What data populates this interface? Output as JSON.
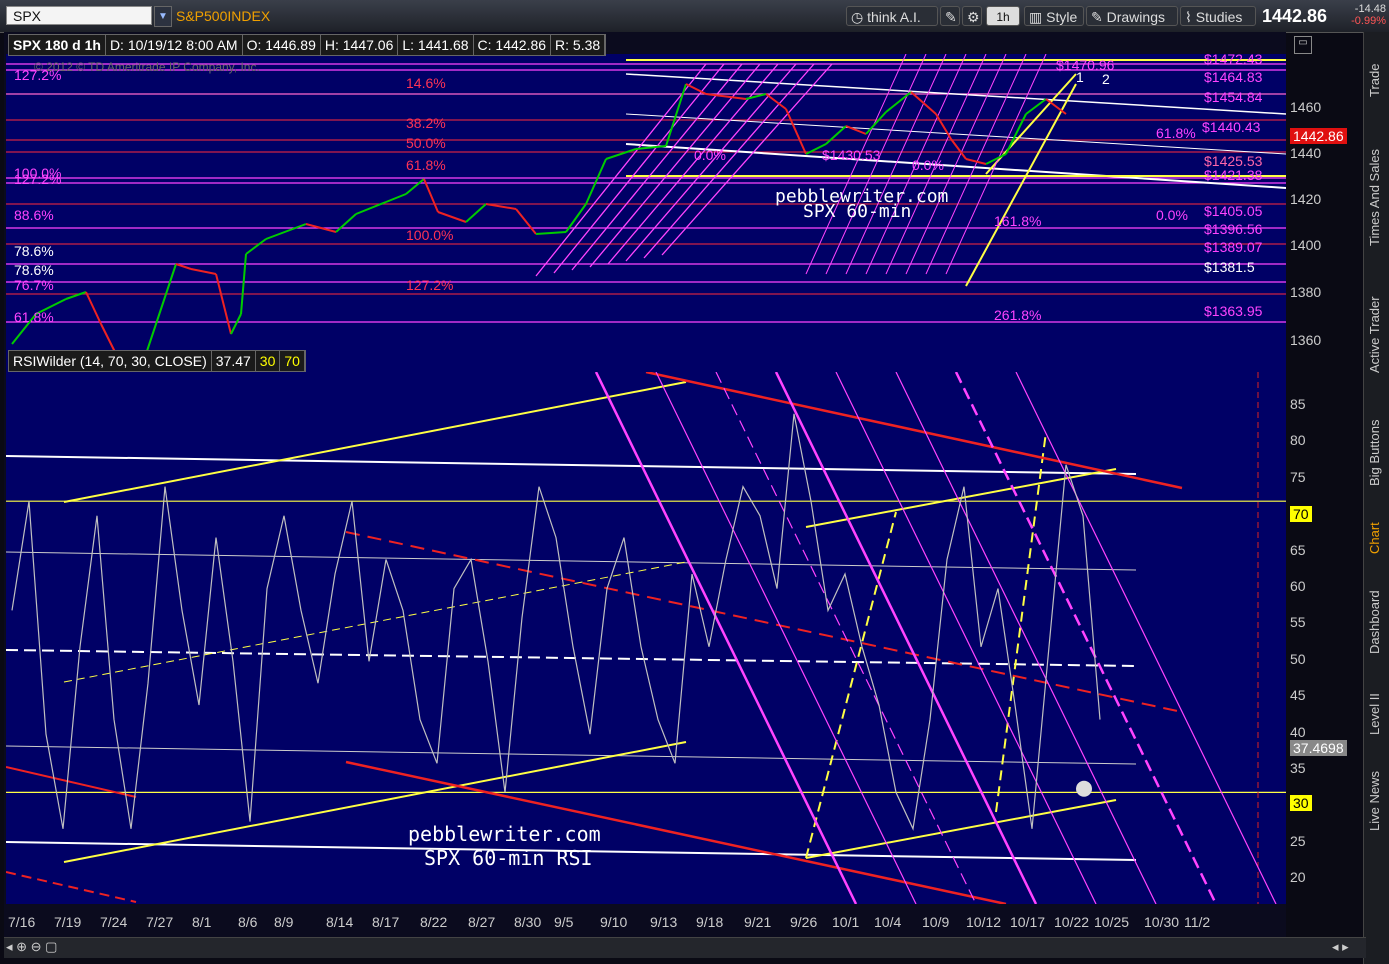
{
  "toolbar": {
    "symbol": "SPX",
    "symbol_name": "S&P500INDEX",
    "think_ai": "think A.I.",
    "timeframe": "1h",
    "style": "Style",
    "drawings": "Drawings",
    "studies": "Studies",
    "last_price": "1442.86",
    "net_change": "-14.48",
    "pct_change": "-0.99%"
  },
  "price_header": {
    "spec": "SPX 180 d 1h",
    "date": "D: 10/19/12 8:00 AM",
    "open": "O: 1446.89",
    "high": "H: 1447.06",
    "low": "L: 1441.68",
    "close": "C: 1442.86",
    "range": "R: 5.38",
    "copyright": "© 2012 © TD Ameritrade IP Company, Inc."
  },
  "rsi_header": {
    "study": "RSIWilder (14, 70, 30, CLOSE)",
    "value": "37.47",
    "oversold": "30",
    "overbought": "70"
  },
  "price_axis": [
    "1460",
    "1440",
    "1420",
    "1400",
    "1380",
    "1360"
  ],
  "price_tag": "1442.86",
  "rsi_axis": [
    "85",
    "80",
    "75",
    "70",
    "65",
    "60",
    "55",
    "50",
    "45",
    "40",
    "35",
    "30",
    "25",
    "20"
  ],
  "rsi_tag": "37.4698",
  "rsi_tag_70": "70",
  "rsi_tag_30": "30",
  "x_axis": [
    "7/16",
    "7/19",
    "7/24",
    "7/27",
    "8/1",
    "8/6",
    "8/9",
    "8/14",
    "8/17",
    "8/22",
    "8/27",
    "8/30",
    "9/5",
    "9/10",
    "9/13",
    "9/18",
    "9/21",
    "9/26",
    "10/1",
    "10/4",
    "10/9",
    "10/12",
    "10/17",
    "10/22",
    "10/25",
    "10/30",
    "11/2"
  ],
  "fib_left": [
    "127.2%",
    "100.0%",
    "127.2%",
    "88.6%",
    "78.6%",
    "78.6%",
    "76.7%",
    "61.8%"
  ],
  "fib_mid": [
    "14.6%",
    "38.2%",
    "50.0%",
    "61.8%",
    "100.0%",
    "127.2%"
  ],
  "fib_right_prices": [
    "$1472.43",
    "$1464.83",
    "$1454.84",
    "$1440.43",
    "$1425.53",
    "$1421.38",
    "$1405.05",
    "$1396.56",
    "$1389.07",
    "$1381.5",
    "$1363.95"
  ],
  "fib_misc": [
    "0.0%",
    "0.0%",
    "$1430.53",
    "0.0%",
    "61.8%",
    "161.8%",
    "261.8%",
    "$1470.96",
    "1",
    "2"
  ],
  "watermark_price": [
    "pebblewriter.com",
    "SPX 60-min"
  ],
  "watermark_rsi": [
    "pebblewriter.com",
    "SPX 60-min RSI"
  ],
  "sidebar": [
    "Trade",
    "Times And Sales",
    "Active Trader",
    "Big Buttons",
    "Chart",
    "Dashboard",
    "Level II",
    "Live News"
  ],
  "colors": {
    "background": "#000066",
    "price_up": "#00cc00",
    "price_down": "#ee2222",
    "rsi_line": "#c0c0c0",
    "accent": "#f0a000"
  }
}
